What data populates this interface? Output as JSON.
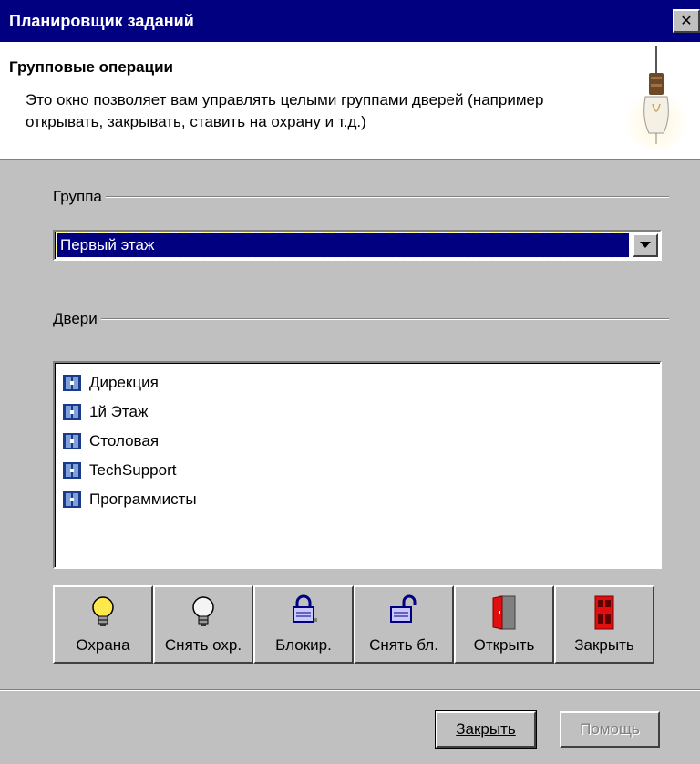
{
  "window": {
    "title": "Планировщик заданий",
    "close_glyph": "✕"
  },
  "header": {
    "heading": "Групповые операции",
    "description": "Это окно позволяет вам управлять целыми группами дверей (например открывать, закрывать, ставить на охрану и т.д.)",
    "icon": "light-bulb-icon"
  },
  "group": {
    "label": "Группа",
    "selected": "Первый этаж"
  },
  "doors": {
    "label": "Двери",
    "items": [
      {
        "label": "Дирекция",
        "icon": "door-icon"
      },
      {
        "label": "1й Этаж",
        "icon": "door-icon"
      },
      {
        "label": "Столовая",
        "icon": "door-icon"
      },
      {
        "label": "TechSupport",
        "icon": "door-icon"
      },
      {
        "label": "Программисты",
        "icon": "door-icon"
      }
    ]
  },
  "actions": [
    {
      "label": "Охрана",
      "icon": "bulb-on-icon"
    },
    {
      "label": "Снять охр.",
      "icon": "bulb-off-icon"
    },
    {
      "label": "Блокир.",
      "icon": "lock-icon"
    },
    {
      "label": "Снять бл.",
      "icon": "unlock-icon"
    },
    {
      "label": "Открыть",
      "icon": "open-door-icon"
    },
    {
      "label": "Закрыть",
      "icon": "closed-door-icon"
    }
  ],
  "footer": {
    "close_label": "Закрыть",
    "help_label": "Помощь"
  },
  "colors": {
    "titlebar": "#000080",
    "face": "#c0c0c0",
    "selection": "#000080"
  }
}
